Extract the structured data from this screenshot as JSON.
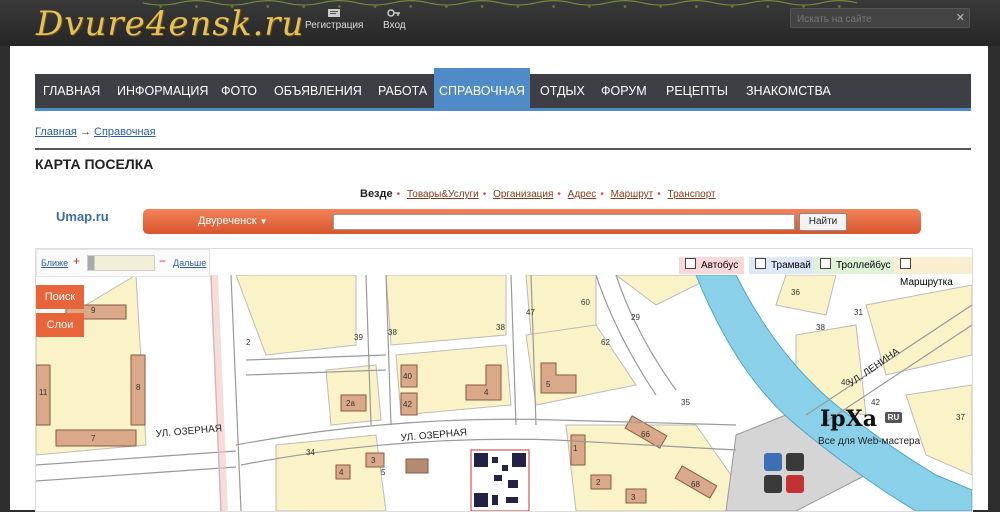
{
  "header": {
    "logo": "Dvure4ensk.ru",
    "register": "Регистрация",
    "login": "Вход",
    "search_placeholder": "Искать на сайте"
  },
  "nav": {
    "items": [
      "ГЛАВНАЯ",
      "ИНФОРМАЦИЯ",
      "ФОТО",
      "ОБЪЯВЛЕНИЯ",
      "РАБОТА",
      "СПРАВОЧНАЯ",
      "ОТДЫХ",
      "ФОРУМ",
      "РЕЦЕПТЫ",
      "ЗНАКОМСТВА"
    ],
    "active": "СПРАВОЧНАЯ"
  },
  "breadcrumb": {
    "home": "Главная",
    "arrow": "→",
    "current": "Справочная"
  },
  "page_title": "КАРТА ПОСЕЛКА",
  "umap": {
    "logo": "Umap.ru",
    "tabs": [
      "Везде",
      "Товары&Услуги",
      "Организация",
      "Адрес",
      "Маршрут",
      "Транспорт"
    ],
    "city": "Двуреченск",
    "search_button": "Найти"
  },
  "map": {
    "zoom_in": "Ближе",
    "zoom_out": "Дальше",
    "side_buttons": [
      "Поиск",
      "Слои"
    ],
    "layers": [
      "Автобус",
      "Трамвай",
      "Троллейбус",
      "Маршрутка"
    ],
    "layer_colors": [
      "#f8d8d8",
      "#dde8f8",
      "#def3d8",
      "#fbeed0"
    ],
    "streets": [
      "УЛ. ОЗЕРНАЯ",
      "УЛ. ОЗЕРНАЯ",
      "УЛ. ЛЕНИНА"
    ],
    "house_numbers": [
      "9",
      "8",
      "11",
      "7",
      "2",
      "39",
      "38",
      "38",
      "47",
      "60",
      "62",
      "29",
      "35",
      "40",
      "42",
      "2а",
      "4",
      "5",
      "36",
      "38",
      "31",
      "40",
      "42",
      "37",
      "34",
      "1",
      "2",
      "3",
      "4",
      "66",
      "68",
      "5",
      "3"
    ]
  },
  "watermark": {
    "brand": "IpXa",
    "tagline": "Все для Web-мастера",
    "badge": "RU"
  }
}
